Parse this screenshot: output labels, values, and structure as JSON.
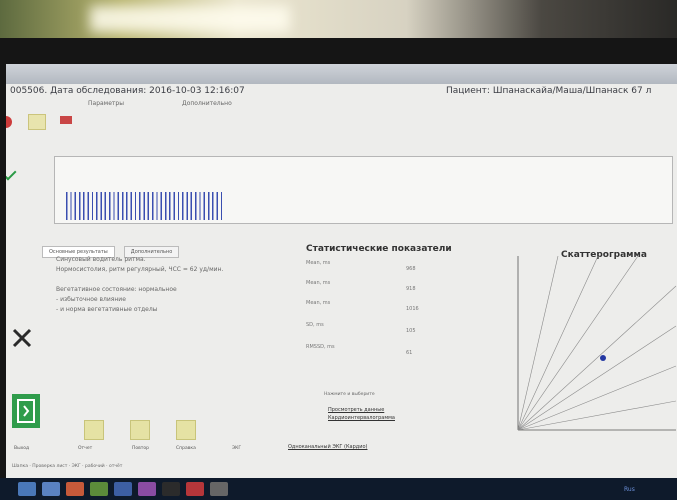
{
  "header": {
    "study_date": "005506. Дата обследования: 2016-10-03 12:16:07",
    "patient": "Пациент: Шпанаскайа/Маша/Шпанаск 67 л"
  },
  "stats": {
    "title": "Статистические показатели",
    "rows": [
      {
        "label": "Mean, ms",
        "value": "968"
      },
      {
        "label": "Mean, ms",
        "value": "918"
      },
      {
        "label": "Mean, ms",
        "value": "1016"
      },
      {
        "label": "SD, ms",
        "value": "105"
      },
      {
        "label": "RMSSD, ms",
        "value": "61"
      }
    ]
  },
  "scatter": {
    "title": "Скаттерограмма"
  },
  "left_panel": {
    "tab_active": "Основные результаты",
    "tab_other": "Дополнительно",
    "lines": [
      "Синусовый водитель ритма.",
      "Нормосистолия, ритм регулярный, ЧСС = 62 уд/мин.",
      "",
      "Вегетативное состояние: нормальное",
      "  - избыточное влияние",
      "  - и норма вегетативные отделы"
    ]
  },
  "bottom": {
    "labels": [
      "Выход",
      "Отчет",
      "Повтор",
      "Справка",
      "ЭКГ"
    ],
    "link": "Одноканальный ЭКГ (Кардио)",
    "status": "Шапка · Проверка лист · ЭКГ · рабочий · отчёт"
  },
  "center_links": {
    "note": "Нажмите и выберите",
    "link1": "Просмотреть данные",
    "link2": "Кардиоинтервалограмма"
  },
  "taskbar": {
    "corner": "Rus"
  }
}
